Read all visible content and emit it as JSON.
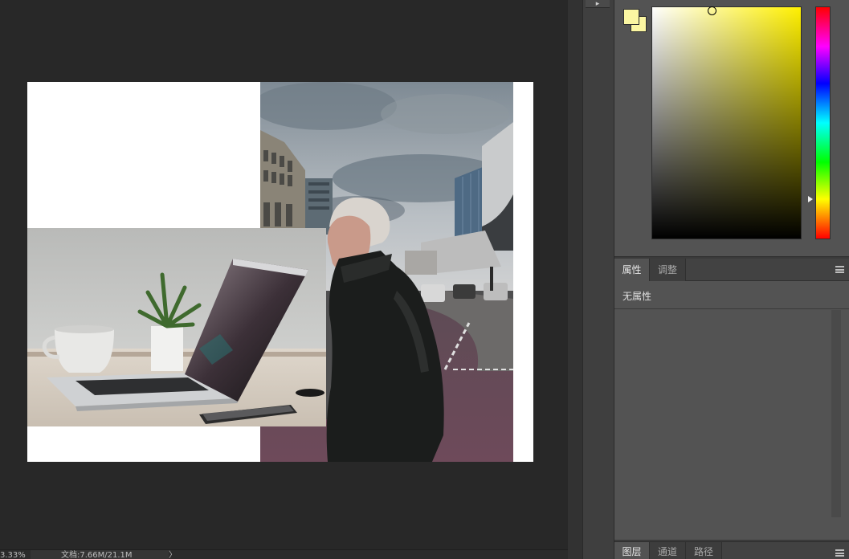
{
  "status": {
    "zoom": "3.33%",
    "doc_info": "文档:7.66M/21.1M",
    "arrow": "〉"
  },
  "color_panel": {
    "foreground_color": "#fbf6a2",
    "background_color": "#fbf6a2",
    "hue_color": "#fff000",
    "icons": [
      "foreground-swatch",
      "background-swatch",
      "color-field",
      "hue-strip"
    ]
  },
  "properties_panel": {
    "tabs": [
      {
        "label": "属性",
        "active": true
      },
      {
        "label": "调整",
        "active": false
      }
    ],
    "empty_text": "无属性"
  },
  "layers_panel": {
    "tabs": [
      {
        "label": "图层",
        "active": true
      },
      {
        "label": "通道",
        "active": false
      },
      {
        "label": "路径",
        "active": false
      }
    ]
  },
  "mini_dock": {
    "tool_glyph": "▸"
  }
}
